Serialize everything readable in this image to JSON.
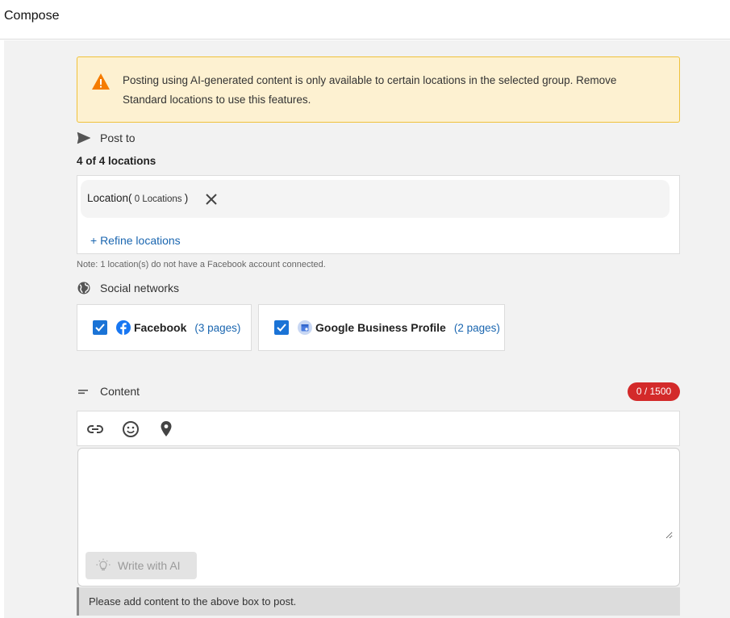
{
  "header": {
    "title": "Compose"
  },
  "warning": {
    "text": "Posting using AI-generated content is only available to certain locations in the selected group. Remove Standard locations to use this features."
  },
  "post_to": {
    "label": "Post to",
    "count_text": "4 of 4 locations",
    "location_chip": {
      "label": "Location(",
      "sub": " 0 Locations ",
      "close": ")"
    },
    "refine_link": "+ Refine locations",
    "note": "Note: 1 location(s) do not have a Facebook account connected."
  },
  "social_networks": {
    "label": "Social networks",
    "items": [
      {
        "name": "Facebook",
        "pages": "(3 pages)",
        "checked": true,
        "icon": "facebook-icon"
      },
      {
        "name": "Google Business Profile",
        "pages": "(2 pages)",
        "checked": true,
        "icon": "google-business-profile-icon"
      }
    ]
  },
  "content": {
    "label": "Content",
    "counter": "0 / 1500",
    "value": "",
    "write_ai_label": "Write with AI",
    "hint": "Please add content to the above box to post."
  },
  "colors": {
    "accent": "#1a73d6",
    "link": "#1a66b0",
    "counter_bg": "#d32a2a",
    "warning_bg": "#fdf1d1",
    "warning_border": "#f0c23b"
  }
}
